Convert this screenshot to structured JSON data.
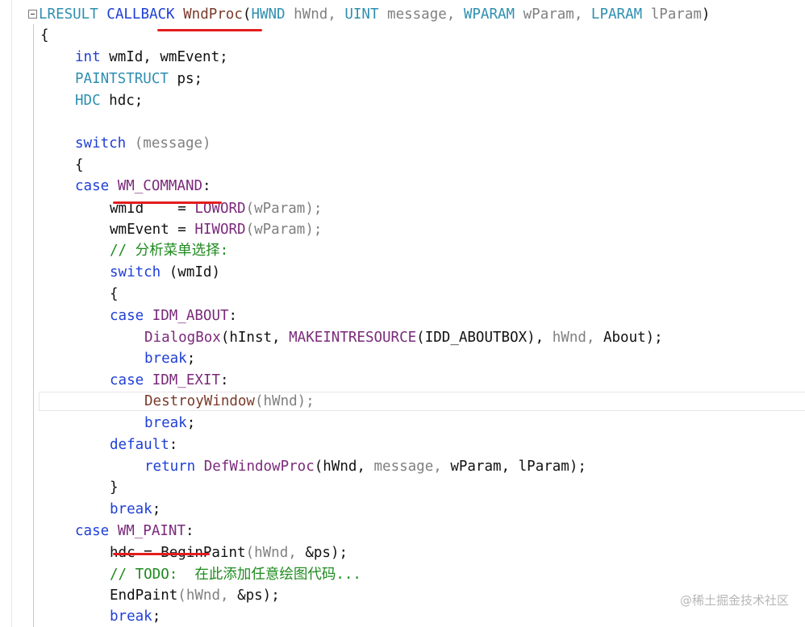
{
  "editor": {
    "lines": [
      {
        "tokens": [
          {
            "t": "LRESULT ",
            "c": "ty"
          },
          {
            "t": "CALLBACK ",
            "c": "kw"
          },
          {
            "t": "WndProc",
            "c": "fn"
          },
          {
            "t": "(",
            "c": "txt"
          },
          {
            "t": "HWND ",
            "c": "ty"
          },
          {
            "t": "hWnd, ",
            "c": "prm"
          },
          {
            "t": "UINT ",
            "c": "ty"
          },
          {
            "t": "message, ",
            "c": "prm"
          },
          {
            "t": "WPARAM ",
            "c": "ty"
          },
          {
            "t": "wParam, ",
            "c": "prm"
          },
          {
            "t": "LPARAM ",
            "c": "ty"
          },
          {
            "t": "lParam",
            "c": "prm"
          },
          {
            "t": ")",
            "c": "txt"
          }
        ]
      },
      {
        "tokens": [
          {
            "t": "{",
            "c": "txt"
          }
        ]
      },
      {
        "tokens": [
          {
            "t": "int ",
            "c": "kw"
          },
          {
            "t": "wmId, wmEvent;",
            "c": "txt"
          }
        ]
      },
      {
        "tokens": [
          {
            "t": "PAINTSTRUCT ",
            "c": "ty"
          },
          {
            "t": "ps;",
            "c": "txt"
          }
        ]
      },
      {
        "tokens": [
          {
            "t": "HDC ",
            "c": "ty"
          },
          {
            "t": "hdc;",
            "c": "txt"
          }
        ]
      },
      {
        "tokens": []
      },
      {
        "tokens": [
          {
            "t": "switch ",
            "c": "kw"
          },
          {
            "t": "(message)",
            "c": "prm"
          }
        ]
      },
      {
        "tokens": [
          {
            "t": "{",
            "c": "txt"
          }
        ]
      },
      {
        "tokens": [
          {
            "t": "case ",
            "c": "kw"
          },
          {
            "t": "WM_COMMAND",
            "c": "mac"
          },
          {
            "t": ":",
            "c": "txt"
          }
        ]
      },
      {
        "tokens": [
          {
            "t": "wmId    = ",
            "c": "txt"
          },
          {
            "t": "LOWORD",
            "c": "mac"
          },
          {
            "t": "(wParam);",
            "c": "prm"
          }
        ]
      },
      {
        "tokens": [
          {
            "t": "wmEvent = ",
            "c": "txt"
          },
          {
            "t": "HIWORD",
            "c": "mac"
          },
          {
            "t": "(wParam);",
            "c": "prm"
          }
        ]
      },
      {
        "tokens": [
          {
            "t": "// 分析菜单选择:",
            "c": "cmt"
          }
        ]
      },
      {
        "tokens": [
          {
            "t": "switch ",
            "c": "kw"
          },
          {
            "t": "(wmId)",
            "c": "txt"
          }
        ]
      },
      {
        "tokens": [
          {
            "t": "{",
            "c": "txt"
          }
        ]
      },
      {
        "tokens": [
          {
            "t": "case ",
            "c": "kw"
          },
          {
            "t": "IDM_ABOUT",
            "c": "mac"
          },
          {
            "t": ":",
            "c": "txt"
          }
        ]
      },
      {
        "tokens": [
          {
            "t": "DialogBox",
            "c": "mac"
          },
          {
            "t": "(hInst, ",
            "c": "txt"
          },
          {
            "t": "MAKEINTRESOURCE",
            "c": "mac"
          },
          {
            "t": "(IDD_ABOUTBOX), ",
            "c": "txt"
          },
          {
            "t": "hWnd, ",
            "c": "prm"
          },
          {
            "t": "About);",
            "c": "txt"
          }
        ]
      },
      {
        "tokens": [
          {
            "t": "break",
            "c": "kw"
          },
          {
            "t": ";",
            "c": "txt"
          }
        ]
      },
      {
        "tokens": [
          {
            "t": "case ",
            "c": "kw"
          },
          {
            "t": "IDM_EXIT",
            "c": "mac"
          },
          {
            "t": ":",
            "c": "txt"
          }
        ]
      },
      {
        "tokens": [
          {
            "t": "DestroyWindow",
            "c": "fn"
          },
          {
            "t": "(hWnd);",
            "c": "prm"
          }
        ]
      },
      {
        "tokens": [
          {
            "t": "break",
            "c": "kw"
          },
          {
            "t": ";",
            "c": "txt"
          }
        ]
      },
      {
        "tokens": [
          {
            "t": "default",
            "c": "kw"
          },
          {
            "t": ":",
            "c": "txt"
          }
        ]
      },
      {
        "tokens": [
          {
            "t": "return ",
            "c": "kw"
          },
          {
            "t": "DefWindowProc",
            "c": "mac"
          },
          {
            "t": "(hWnd, ",
            "c": "txt"
          },
          {
            "t": "message, ",
            "c": "prm"
          },
          {
            "t": "wParam, ",
            "c": "txt"
          },
          {
            "t": "lParam);",
            "c": "txt"
          }
        ]
      },
      {
        "tokens": [
          {
            "t": "}",
            "c": "txt"
          }
        ]
      },
      {
        "tokens": [
          {
            "t": "break",
            "c": "kw"
          },
          {
            "t": ";",
            "c": "txt"
          }
        ]
      },
      {
        "tokens": [
          {
            "t": "case ",
            "c": "kw"
          },
          {
            "t": "WM_PAINT",
            "c": "mac"
          },
          {
            "t": ":",
            "c": "txt"
          }
        ]
      },
      {
        "tokens": [
          {
            "t": "hdc = BeginPaint",
            "c": "txt"
          },
          {
            "t": "(hWnd, ",
            "c": "prm"
          },
          {
            "t": "&ps);",
            "c": "txt"
          }
        ]
      },
      {
        "tokens": [
          {
            "t": "// TODO:  在此添加任意绘图代码...",
            "c": "cmt"
          }
        ]
      },
      {
        "tokens": [
          {
            "t": "EndPaint",
            "c": "txt"
          },
          {
            "t": "(hWnd, ",
            "c": "prm"
          },
          {
            "t": "&ps);",
            "c": "txt"
          }
        ]
      },
      {
        "tokens": [
          {
            "t": "break",
            "c": "kw"
          },
          {
            "t": ";",
            "c": "txt"
          }
        ]
      }
    ]
  },
  "watermark": "@稀土掘金技术社区",
  "colors": {
    "keyword": "#1f3fd6",
    "type": "#2e8fb0",
    "comment": "#1d8a1d",
    "macro": "#7a2a7a",
    "annotation": "#e41d1d"
  }
}
